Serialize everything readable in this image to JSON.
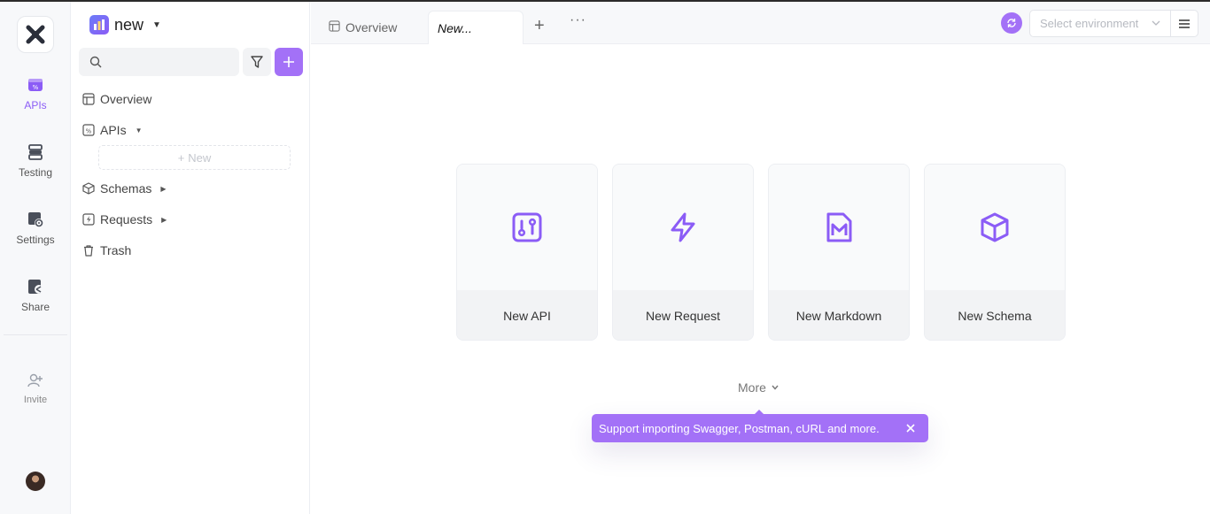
{
  "rail": {
    "items": [
      {
        "label": "APIs"
      },
      {
        "label": "Testing"
      },
      {
        "label": "Settings"
      },
      {
        "label": "Share"
      },
      {
        "label": "Invite"
      }
    ]
  },
  "sidebar": {
    "project_name": "new",
    "search": {
      "placeholder": ""
    },
    "tree": [
      {
        "label": "Overview"
      },
      {
        "label": "APIs"
      },
      {
        "label": "Schemas"
      },
      {
        "label": "Requests"
      },
      {
        "label": "Trash"
      }
    ],
    "new_label": "New"
  },
  "tabs": [
    {
      "label": "Overview"
    },
    {
      "label": "New..."
    }
  ],
  "environment": {
    "placeholder": "Select environment"
  },
  "cards": [
    {
      "label": "New API",
      "icon": "api-icon"
    },
    {
      "label": "New Request",
      "icon": "lightning-icon"
    },
    {
      "label": "New Markdown",
      "icon": "markdown-icon"
    },
    {
      "label": "New Schema",
      "icon": "cube-icon"
    }
  ],
  "more_label": "More",
  "tooltip": {
    "text": "Support importing Swagger, Postman, cURL and more."
  },
  "colors": {
    "accent": "#a371f7",
    "accent_icon": "#8b5cf6"
  }
}
